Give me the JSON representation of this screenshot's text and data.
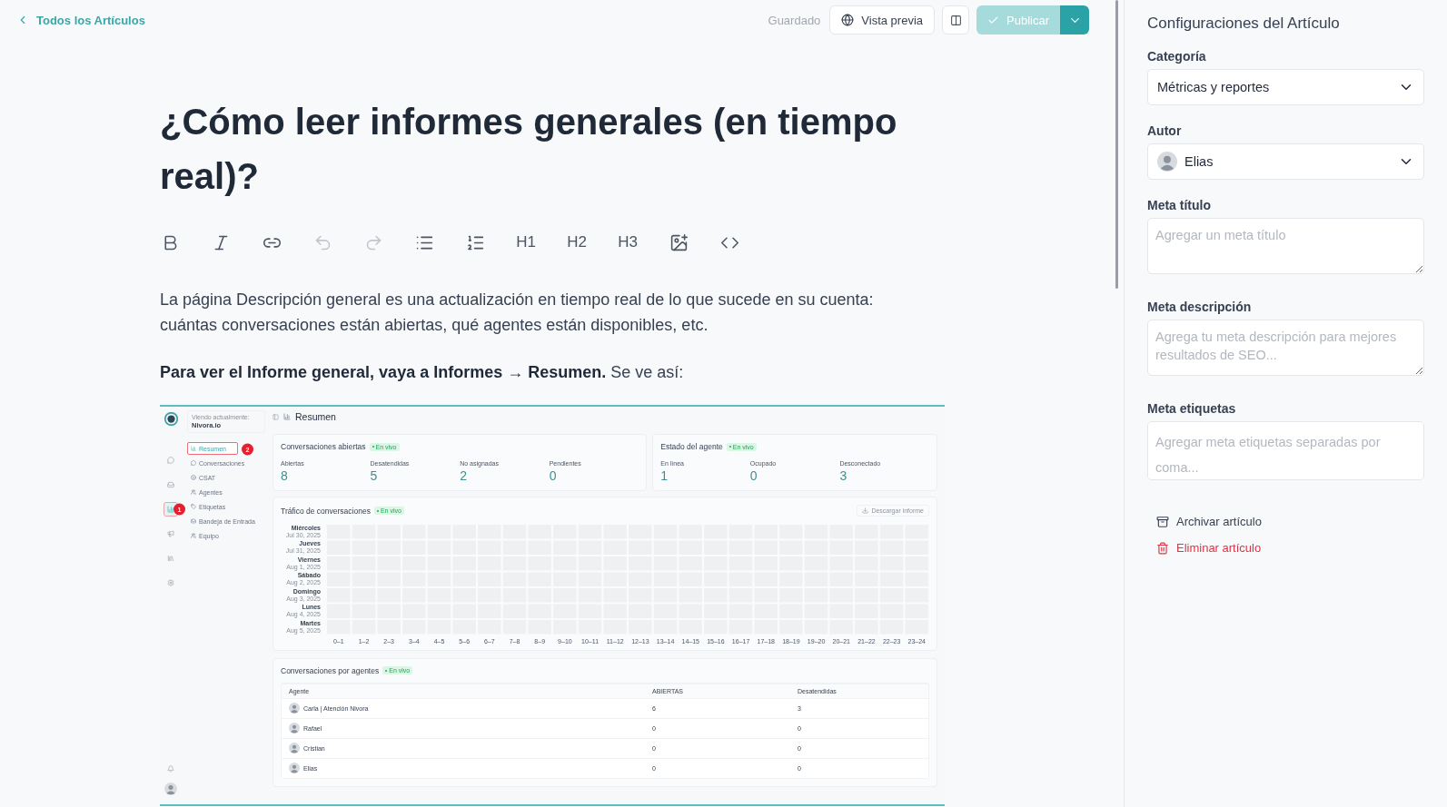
{
  "topbar": {
    "back_link": "Todos los Artículos",
    "save_status": "Guardado",
    "preview_button": "Vista previa",
    "publish_button": "Publicar",
    "publish_disabled": true
  },
  "article": {
    "title": "¿Cómo leer informes generales (en tiempo real)?",
    "toolbar": [
      {
        "kind": "bold",
        "disabled": false
      },
      {
        "kind": "italic",
        "disabled": false
      },
      {
        "kind": "link",
        "disabled": false
      },
      {
        "kind": "undo",
        "disabled": true
      },
      {
        "kind": "redo",
        "disabled": true
      },
      {
        "kind": "bullet_list",
        "disabled": false
      },
      {
        "kind": "ordered_list",
        "disabled": false
      },
      {
        "kind": "heading",
        "label": "H1",
        "disabled": false
      },
      {
        "kind": "heading",
        "label": "H2",
        "disabled": false
      },
      {
        "kind": "heading",
        "label": "H3",
        "disabled": false
      },
      {
        "kind": "image",
        "disabled": false
      },
      {
        "kind": "code",
        "disabled": false
      }
    ],
    "paragraphs": [
      "La página Descripción general es una actualización en tiempo real de lo que sucede en su cuenta: cuántas conversaciones están abiertas, qué agentes están disponibles, etc.",
      "**Para ver el Informe general, vaya a Informes → Resumen.** Se ve así:"
    ],
    "screenshot": {
      "workspace_label": "Viendo actualmente:",
      "workspace": "Nivora.io",
      "rail": [
        {
          "kind": "chat",
          "selected": false
        },
        {
          "kind": "inbox",
          "selected": false
        },
        {
          "kind": "reports",
          "selected": true,
          "callout": "1"
        },
        {
          "kind": "campaigns",
          "selected": false
        },
        {
          "kind": "library",
          "selected": false
        },
        {
          "kind": "settings",
          "selected": false
        }
      ],
      "nav": [
        {
          "kind": "reports",
          "label": "Resumen",
          "selected": true,
          "callout": "2"
        },
        {
          "kind": "chat",
          "label": "Conversaciones",
          "selected": false
        },
        {
          "kind": "smile",
          "label": "CSAT",
          "selected": false
        },
        {
          "kind": "people",
          "label": "Agentes",
          "selected": false
        },
        {
          "kind": "tag",
          "label": "Etiquetas",
          "selected": false
        },
        {
          "kind": "inbox",
          "label": "Bandeja de Entrada",
          "selected": false
        },
        {
          "kind": "people",
          "label": "Equipo",
          "selected": false
        }
      ],
      "page_title": "Resumen",
      "cards": [
        {
          "title": "Conversaciones abiertas",
          "live": "En vivo",
          "stats": [
            {
              "label": "Abiertas",
              "value": "8"
            },
            {
              "label": "Desatendidas",
              "value": "5"
            },
            {
              "label": "No asignadas",
              "value": "2"
            },
            {
              "label": "Pendientes",
              "value": "0"
            }
          ]
        },
        {
          "title": "Estado del agente",
          "live": "En vivo",
          "stats": [
            {
              "label": "En línea",
              "value": "1"
            },
            {
              "label": "Ocupado",
              "value": "0"
            },
            {
              "label": "Desconectado",
              "value": "3"
            }
          ]
        }
      ],
      "traffic": {
        "title": "Tráfico de conversaciones",
        "live": "En vivo",
        "download": "Descargar informe",
        "days": [
          {
            "day": "Miércoles",
            "date": "Jul 30, 2025"
          },
          {
            "day": "Jueves",
            "date": "Jul 31, 2025"
          },
          {
            "day": "Viernes",
            "date": "Aug 1, 2025"
          },
          {
            "day": "Sábado",
            "date": "Aug 2, 2025"
          },
          {
            "day": "Domingo",
            "date": "Aug 3, 2025"
          },
          {
            "day": "Lunes",
            "date": "Aug 4, 2025"
          },
          {
            "day": "Martes",
            "date": "Aug 5, 2025"
          }
        ],
        "hours": [
          "0–1",
          "1–2",
          "2–3",
          "3–4",
          "4–5",
          "5–6",
          "6–7",
          "7–8",
          "8–9",
          "9–10",
          "10–11",
          "11–12",
          "12–13",
          "13–14",
          "14–15",
          "15–16",
          "16–17",
          "17–18",
          "18–19",
          "19–20",
          "20–21",
          "21–22",
          "22–23",
          "23–24"
        ]
      },
      "agents": {
        "title": "Conversaciones por agentes",
        "live": "En vivo",
        "columns": [
          "Agente",
          "ABIERTAS",
          "Desatendidas"
        ],
        "rows": [
          {
            "name": "Carla | Atención Nivora",
            "open": "6",
            "unattended": "3"
          },
          {
            "name": "Rafael",
            "open": "0",
            "unattended": "0"
          },
          {
            "name": "Cristian",
            "open": "0",
            "unattended": "0"
          },
          {
            "name": "Elias",
            "open": "0",
            "unattended": "0"
          }
        ]
      }
    }
  },
  "settings": {
    "title": "Configuraciones del Artículo",
    "fields": [
      {
        "kind": "select",
        "label": "Categoría",
        "value": "Métricas y reportes"
      },
      {
        "kind": "author",
        "label": "Autor",
        "value": "Elias"
      },
      {
        "kind": "textarea",
        "label": "Meta título",
        "placeholder": "Agregar un meta título"
      },
      {
        "kind": "textarea",
        "label": "Meta descripción",
        "placeholder": "Agrega tu meta descripción para mejores resultados de SEO..."
      },
      {
        "kind": "tags",
        "label": "Meta etiquetas",
        "placeholder": "Agregar meta etiquetas separadas por coma..."
      }
    ],
    "actions": [
      {
        "kind": "archive",
        "label": "Archivar artículo"
      },
      {
        "kind": "delete",
        "label": "Eliminar artículo"
      }
    ]
  }
}
